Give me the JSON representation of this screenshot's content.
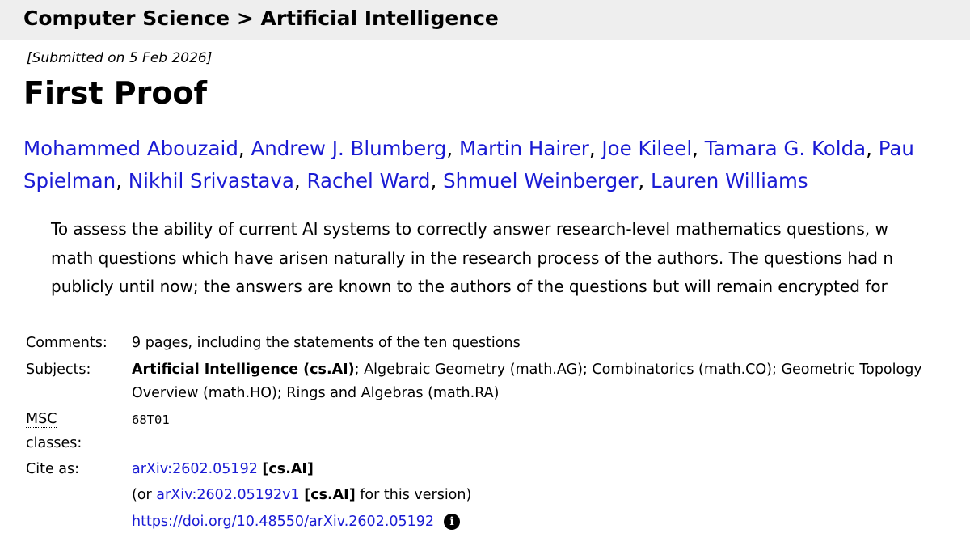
{
  "header": {
    "breadcrumb": "Computer Science > Artificial Intelligence"
  },
  "paper": {
    "dateline": "[Submitted on 5 Feb 2026]",
    "title": "First Proof",
    "authors_row1": [
      "Mohammed Abouzaid",
      "Andrew J. Blumberg",
      "Martin Hairer",
      "Joe Kileel",
      "Tamara G. Kolda",
      "Pau"
    ],
    "authors_row2": [
      "Spielman",
      "Nikhil Srivastava",
      "Rachel Ward",
      "Shmuel Weinberger",
      "Lauren Williams"
    ],
    "separator": ", ",
    "abstract_lines": [
      "To assess the ability of current AI systems to correctly answer research-level mathematics questions, w",
      "math questions which have arisen naturally in the research process of the authors. The questions had n",
      "publicly until now; the answers are known to the authors of the questions but will remain encrypted for"
    ]
  },
  "metadata": {
    "comments_label": "Comments:",
    "comments_value": "9 pages, including the statements of the ten questions",
    "subjects_label": "Subjects:",
    "subjects_primary": "Artificial Intelligence (cs.AI)",
    "subjects_rest_line1": "; Algebraic Geometry (math.AG); Combinatorics (math.CO); Geometric Topology",
    "subjects_line2": "Overview (math.HO); Rings and Algebras (math.RA)",
    "msc_label_abbr": "MSC",
    "msc_label_rest": "classes:",
    "msc_value": "68T01",
    "cite_label": "Cite as:",
    "cite_id": "arXiv:2602.05192",
    "cite_category": "[cs.AI]",
    "cite_version_prefix": "(or ",
    "cite_version_id": "arXiv:2602.05192v1",
    "cite_version_category": "[cs.AI]",
    "cite_version_suffix": " for this version)",
    "doi_link": "https://doi.org/10.48550/arXiv.2602.05192",
    "info_glyph": "i"
  },
  "colors": {
    "link": "#1a1bd4",
    "header_bg": "#eeeeee"
  },
  "icons": {
    "info": "info-icon"
  }
}
